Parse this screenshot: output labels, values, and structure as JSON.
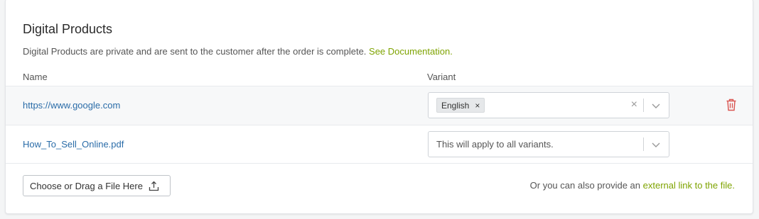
{
  "section": {
    "title": "Digital Products",
    "description": "Digital Products are private and are sent to the customer after the order is complete.",
    "doc_link": "See Documentation."
  },
  "columns": {
    "name": "Name",
    "variant": "Variant"
  },
  "rows": [
    {
      "file": "https://www.google.com",
      "variant_chip": "English"
    },
    {
      "file": "How_To_Sell_Online.pdf",
      "variant_placeholder": "This will apply to all variants."
    }
  ],
  "upload": {
    "button_label": "Choose or Drag a File Here",
    "icon": "upload-icon"
  },
  "external": {
    "prefix": "Or you can also provide an",
    "link": "external link to the file."
  },
  "colors": {
    "accent_green": "#7ea300",
    "link_blue": "#2a6ca8",
    "danger_red": "#d9534f"
  }
}
